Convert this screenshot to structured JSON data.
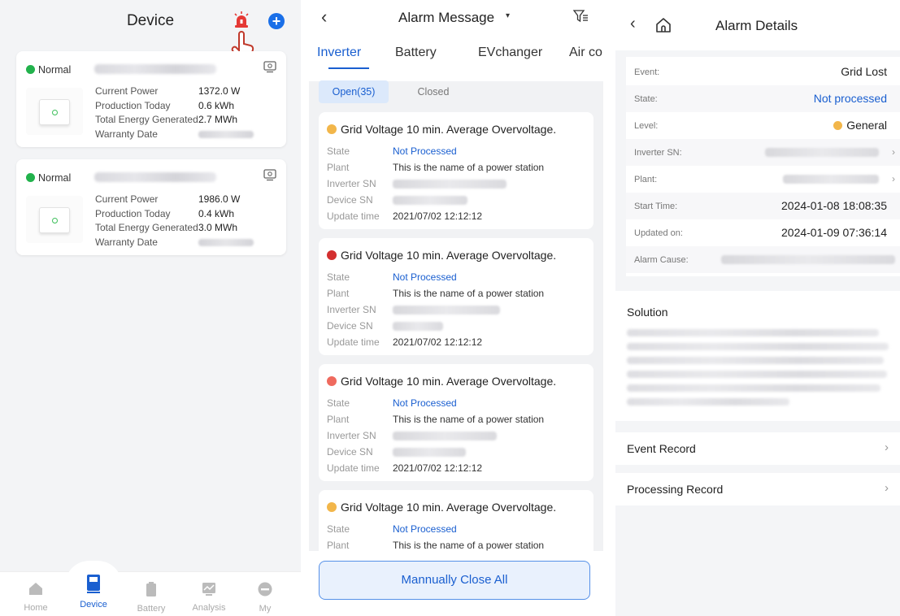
{
  "device_screen": {
    "title": "Device",
    "cards": [
      {
        "status": "Normal",
        "labels": [
          "Current Power",
          "Production Today",
          "Total Energy Generated",
          "Warranty Date"
        ],
        "values": [
          "1372.0 W",
          "0.6 kWh",
          "2.7 MWh"
        ]
      },
      {
        "status": "Normal",
        "labels": [
          "Current Power",
          "Production Today",
          "Total Energy Generated",
          "Warranty Date"
        ],
        "values": [
          "1986.0 W",
          "0.4 kWh",
          "3.0 MWh"
        ]
      }
    ],
    "tabbar": [
      {
        "label": "Home",
        "icon": "home-icon"
      },
      {
        "label": "Device",
        "icon": "device-icon"
      },
      {
        "label": "Battery",
        "icon": "battery-icon"
      },
      {
        "label": "Analysis",
        "icon": "analysis-icon"
      },
      {
        "label": "My",
        "icon": "user-icon"
      }
    ],
    "colors": {
      "normal": "#22b24c",
      "accent": "#1a5fd0",
      "alarm": "#e53935"
    }
  },
  "alarm_screen": {
    "back": "‹",
    "title": "Alarm Message",
    "caret": "▾",
    "tabs": [
      "Inverter",
      "Battery",
      "EVchanger",
      "Air co"
    ],
    "segments": {
      "open": "Open(35)",
      "closed": "Closed"
    },
    "field_labels": [
      "State",
      "Plant",
      "Inverter SN",
      "Device SN",
      "Update time"
    ],
    "alarms": [
      {
        "title": "Grid Voltage 10 min. Average Overvoltage.",
        "dot": "#f2b64a",
        "state": "Not Processed",
        "plant": "This is the name of a power station",
        "update": "2021/07/02 12:12:12"
      },
      {
        "title": "Grid Voltage 10 min. Average Overvoltage.",
        "dot": "#d32f2f",
        "state": "Not Processed",
        "plant": "This is the name of a power station",
        "update": "2021/07/02 12:12:12"
      },
      {
        "title": "Grid Voltage 10 min. Average Overvoltage.",
        "dot": "#ef6a5e",
        "state": "Not Processed",
        "plant": "This is the name of a power station",
        "update": "2021/07/02 12:12:12"
      },
      {
        "title": "Grid Voltage 10 min. Average Overvoltage.",
        "dot": "#f2b64a",
        "state": "Not Processed",
        "plant": "This is the name of a power station"
      }
    ],
    "close_all": "Mannually Close All"
  },
  "details_screen": {
    "back": "‹",
    "title": "Alarm Details",
    "rows": [
      {
        "key": "Event:",
        "value": "Grid Lost"
      },
      {
        "key": "State:",
        "value": "Not processed"
      },
      {
        "key": "Level:",
        "value": "General"
      },
      {
        "key": "Inverter SN:",
        "value": ""
      },
      {
        "key": "Plant:",
        "value": ""
      },
      {
        "key": "Start Time:",
        "value": "2024-01-08 18:08:35"
      },
      {
        "key": "Updated on:",
        "value": "2024-01-09 07:36:14"
      },
      {
        "key": "Alarm Cause:",
        "value": ""
      }
    ],
    "solution_title": "Solution",
    "event_record": "Event Record",
    "processing_record": "Processing Record",
    "level_color": "#f2b64a"
  }
}
